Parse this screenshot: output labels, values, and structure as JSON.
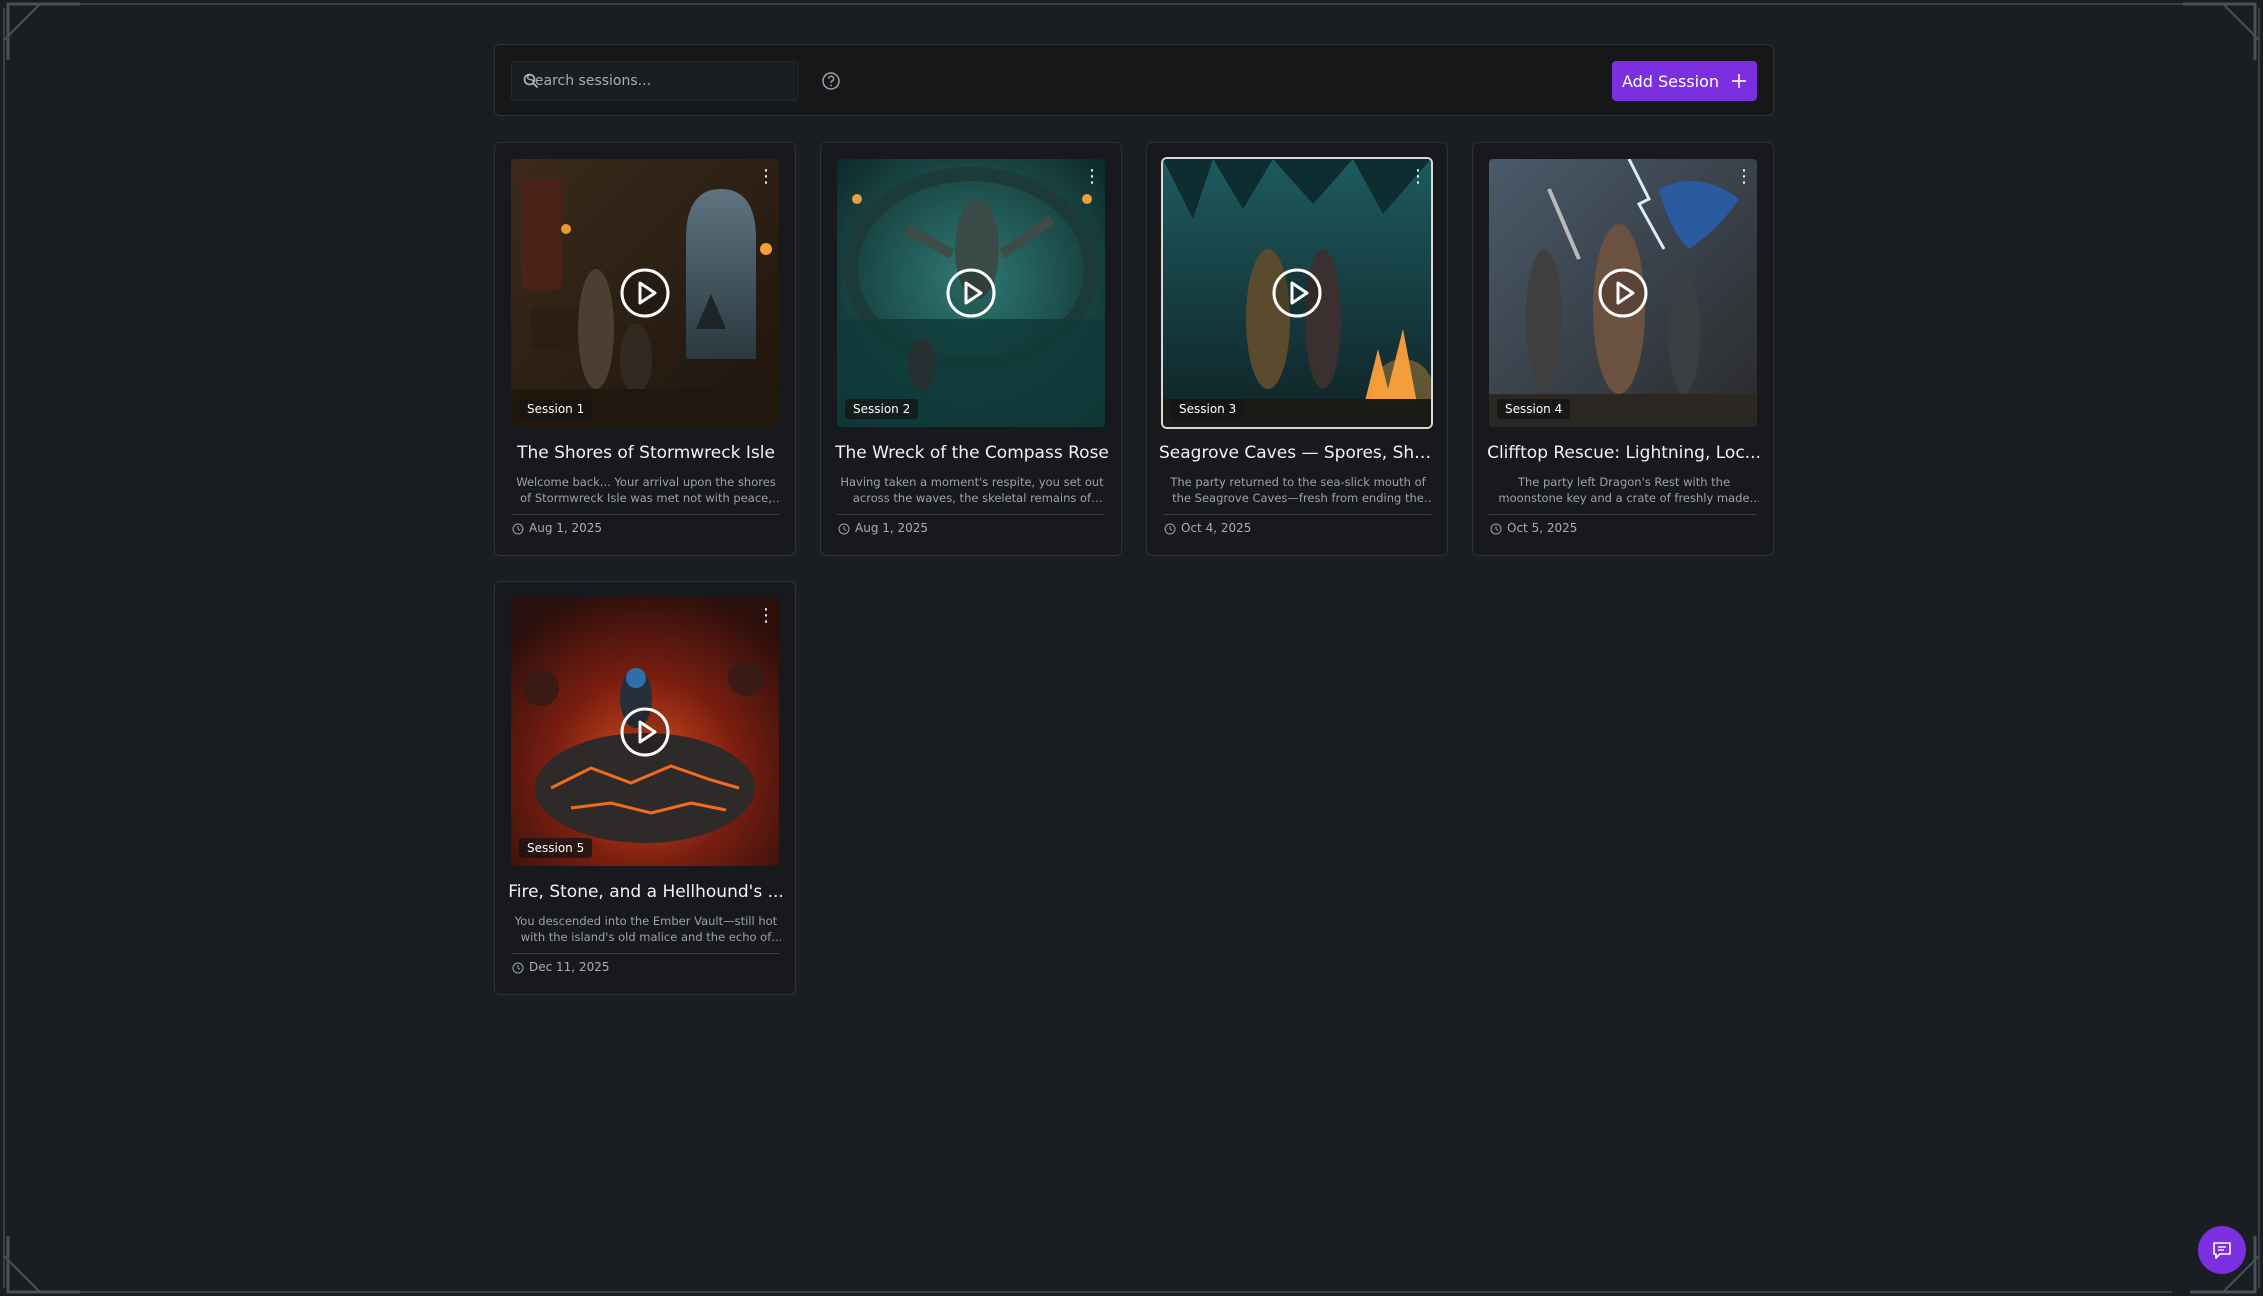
{
  "search": {
    "placeholder": "Search sessions..."
  },
  "toolbar": {
    "add_label": "Add Session"
  },
  "colors": {
    "accent": "#7b2fe0",
    "background": "#1a1d21",
    "card": "#17191c",
    "border": "#2e3237"
  },
  "sessions": [
    {
      "badge": "Session 1",
      "title": "The Shores of Stormwreck Isle",
      "description": "Welcome back... Your arrival upon the shores of Stormwreck Isle was met not with peace, but wit...",
      "date": "Aug 1, 2025"
    },
    {
      "badge": "Session 2",
      "title": "The Wreck of the Compass Rose",
      "description": "Having taken a moment's respite, you set out across the waves, the skeletal remains of ancient...",
      "date": "Aug 1, 2025"
    },
    {
      "badge": "Session 3",
      "title": "Seagrove Caves — Spores, Sha...",
      "description": "The party returned to the sea-slick mouth of the Seagrove Caves—fresh from ending the Compas...",
      "date": "Oct 4, 2025"
    },
    {
      "badge": "Session 4",
      "title": "Clifftop Rescue: Lightning, Loc...",
      "description": "The party left Dragon's Rest with the moonstone key and a crate of freshly made potions, cutting...",
      "date": "Oct 5, 2025"
    },
    {
      "badge": "Session 5",
      "title": "Fire, Stone, and a Hellhound's ...",
      "description": "You descended into the Ember Vault—still hot with the island's old malice and the echo of Runara's...",
      "date": "Dec 11, 2025"
    }
  ],
  "icons": {
    "search": "search-icon",
    "help": "help-icon",
    "add": "plus-icon",
    "play": "play-icon",
    "menu": "kebab-menu-icon",
    "date": "clock-icon",
    "chat": "chat-icon"
  }
}
